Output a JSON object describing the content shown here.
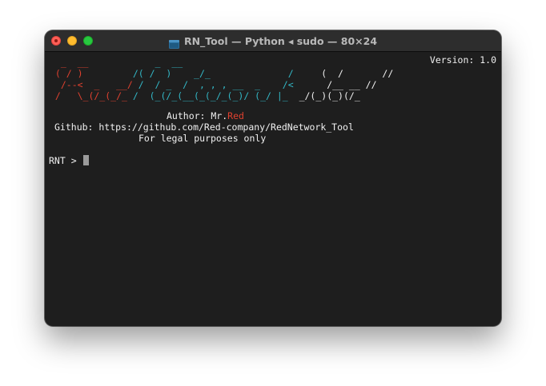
{
  "window": {
    "title": "RN_Tool — Python ◂ sudo — 80×24"
  },
  "terminal": {
    "version": "Version: 1.0",
    "banner": [
      {
        "red": "  _  __",
        "cyan": "            _  __",
        "white": ""
      },
      {
        "red": " ( / )",
        "cyan": "         /( /  )    _/_              /",
        "white": "     (  /       //"
      },
      {
        "red": "  /--<  _   __/",
        "cyan": " /  / _  /  , , , __  _    /<",
        "white": "      /__ __ //"
      },
      {
        "red": " /   \\_(/_(_/_",
        "cyan": " /  (_(/_(__(_(_/_(_)/ (_/ |_",
        "white": "  _/(_)(_)(/_"
      }
    ],
    "author_prefix": "Author: Mr.",
    "author_name": "Red",
    "github_line": "Github: https://github.com/Red-company/RedNetwork_Tool",
    "legal_line": "For legal purposes only",
    "prompt": "RNT > "
  },
  "colors": {
    "red": "#e0412f",
    "cyan": "#33b8c7",
    "background": "#1e1e1e"
  }
}
